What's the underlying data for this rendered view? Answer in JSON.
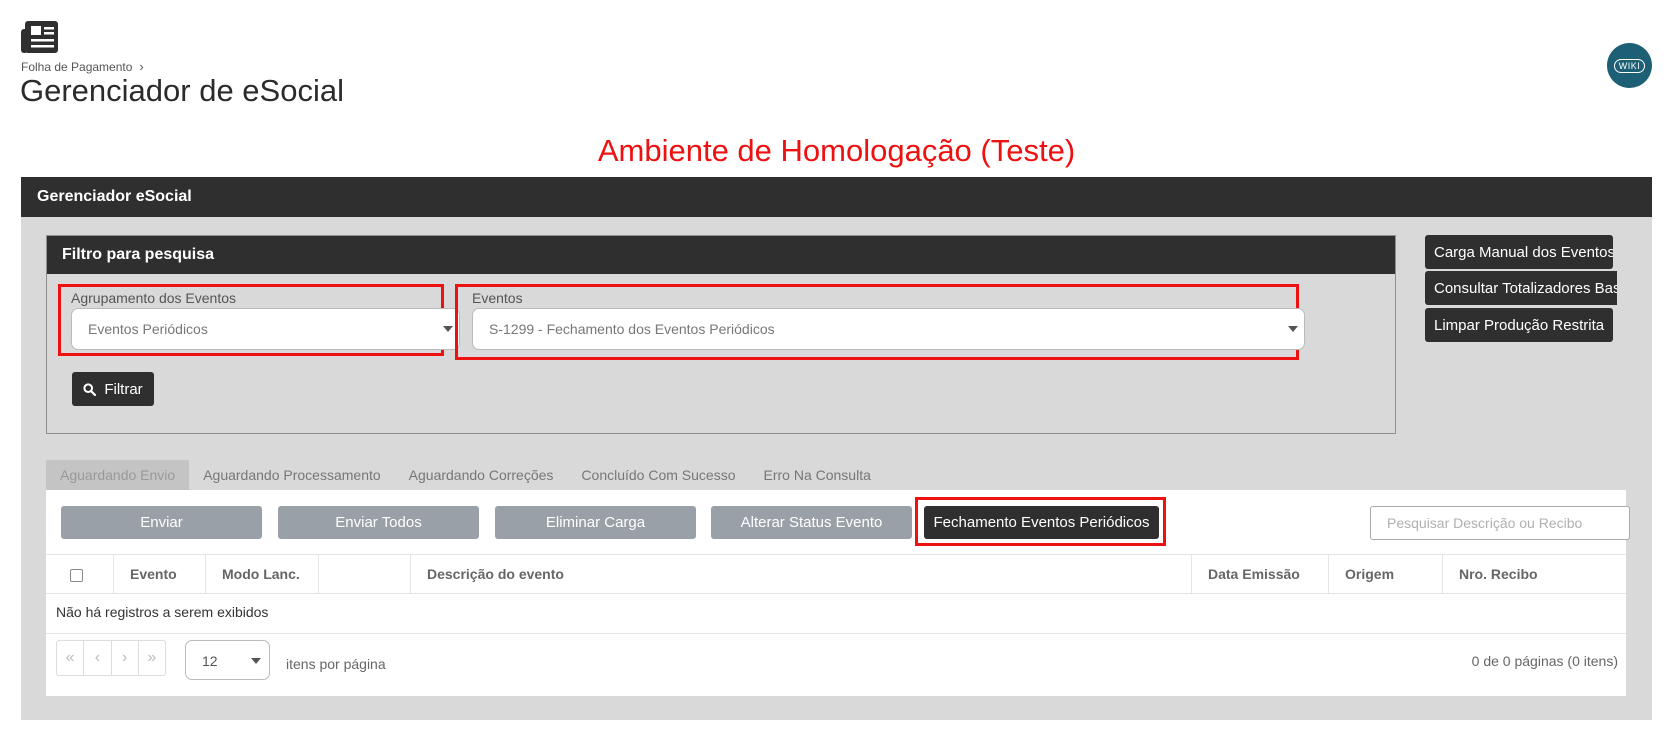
{
  "header": {
    "breadcrumb": "Folha de Pagamento",
    "breadcrumb_separator": "›",
    "title": "Gerenciador de eSocial",
    "wiki_label": "WIKI"
  },
  "environment_banner": "Ambiente de Homologação (Teste)",
  "panel": {
    "title": "Gerenciador eSocial"
  },
  "filter": {
    "title": "Filtro para pesquisa",
    "group_label": "Agrupamento dos Eventos",
    "group_value": "Eventos Periódicos",
    "events_label": "Eventos",
    "events_value": "S-1299 - Fechamento dos Eventos Periódicos",
    "filter_button": "Filtrar"
  },
  "side_buttons": [
    "Carga Manual dos Eventos",
    "Consultar Totalizadores Base",
    "Limpar Produção Restrita"
  ],
  "tabs": [
    "Aguardando Envio",
    "Aguardando Processamento",
    "Aguardando Correções",
    "Concluído Com Sucesso",
    "Erro Na Consulta"
  ],
  "actions": [
    "Enviar",
    "Enviar Todos",
    "Eliminar Carga",
    "Alterar Status Evento",
    "Fechamento Eventos Periódicos"
  ],
  "search_placeholder": "Pesquisar Descrição ou Recibo",
  "grid": {
    "columns": [
      "Evento",
      "Modo Lanc.",
      "",
      "Descrição do evento",
      "Data Emissão",
      "Origem",
      "Nro. Recibo"
    ],
    "empty_message": "Não há registros a serem exibidos"
  },
  "pagination": {
    "first": "«",
    "prev": "‹",
    "next": "›",
    "last": "»",
    "page_size": "12",
    "per_page_label": "itens por página",
    "info": "0 de 0 páginas (0 itens)"
  },
  "colors": {
    "dark": "#2f2f2f",
    "highlight": "#ee1111",
    "disabled_button": "#9aa0a7",
    "panel_bg": "#d9d9d9"
  }
}
